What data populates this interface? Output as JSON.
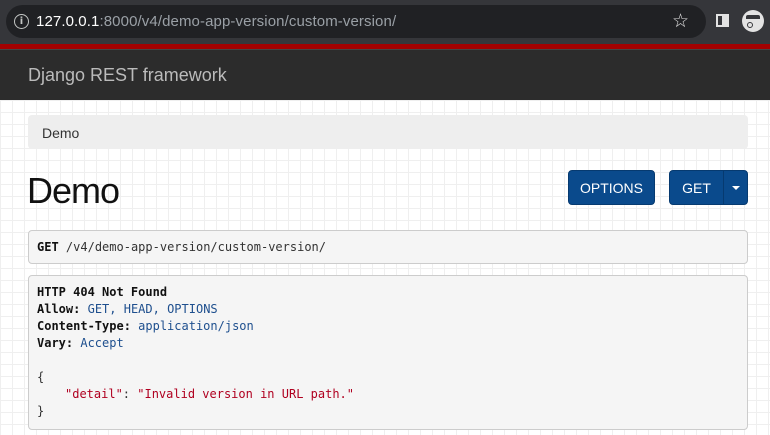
{
  "browser": {
    "url_host": "127.0.0.1",
    "url_rest": ":8000/v4/demo-app-version/custom-version/"
  },
  "navbar": {
    "brand": "Django REST framework"
  },
  "breadcrumb": {
    "item": "Demo"
  },
  "page": {
    "title": "Demo"
  },
  "buttons": {
    "options": "OPTIONS",
    "get": "GET"
  },
  "request": {
    "method": "GET",
    "path": "/v4/demo-app-version/custom-version/"
  },
  "response": {
    "status": "HTTP 404 Not Found",
    "headers": [
      {
        "name": "Allow:",
        "value": "GET, HEAD, OPTIONS"
      },
      {
        "name": "Content-Type:",
        "value": "application/json"
      },
      {
        "name": "Vary:",
        "value": "Accept"
      }
    ],
    "body": {
      "open": "{",
      "key": "\"detail\"",
      "colon": ": ",
      "value": "\"Invalid version in URL path.\"",
      "close": "}"
    }
  },
  "colors": {
    "primary_button": "#0a4a8c",
    "navbar": "#2c2c2c",
    "accent_strip": "#a30000"
  }
}
